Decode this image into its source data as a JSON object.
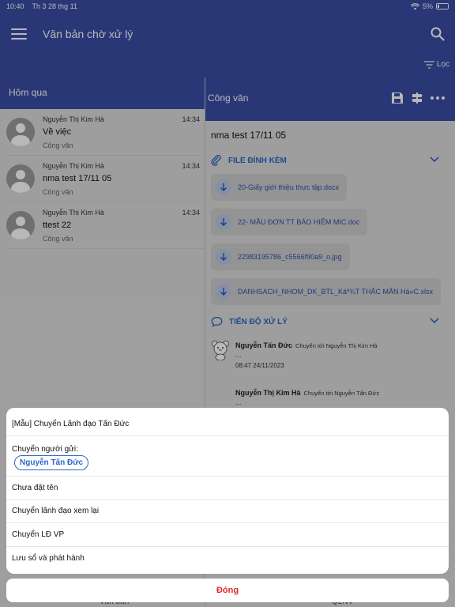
{
  "status_bar": {
    "time": "10:40",
    "date": "Th 3 28 thg 11",
    "battery": "5%"
  },
  "header": {
    "title": "Văn bản chờ xử lý",
    "filter_label": "Lọc"
  },
  "list": {
    "group_label": "Hôm qua",
    "items": [
      {
        "sender": "Nguyễn Thị Kim Hà",
        "time": "14:34",
        "subject": "Về việc",
        "type": "Công văn"
      },
      {
        "sender": "Nguyễn Thị Kim Hà",
        "time": "14:34",
        "subject": "nma test 17/11 05",
        "type": "Công văn"
      },
      {
        "sender": "Nguyễn Thị Kim Hà",
        "time": "14:34",
        "subject": "ttest 22",
        "type": "Công văn"
      }
    ]
  },
  "detail": {
    "header_label": "Công văn",
    "title": "nma test 17/11 05",
    "attachments_label": "FILE ĐÍNH KÈM",
    "attachments": [
      "20-Giấy giới thiệu thực tập.docx",
      "22- MẪU ĐƠN TT BẢO HIỂM MIC.doc",
      "22983195786_c5566f90a9_o.jpg",
      "DANHSACH_NHOM_DK_BTL_Káº¾T THÃC MÃN Há»C.xlsx"
    ],
    "progress_label": "TIẾN ĐỘ XỬ LÝ",
    "progress": [
      {
        "name": "Nguyễn Tấn  Đức",
        "action": "Chuyển tới Nguyễn Thị Kim Hà",
        "note": "...",
        "timestamp": "08:47 24/11/2023"
      },
      {
        "name": "Nguyễn Thị Kim Hà",
        "action": "Chuyển tới Nguyễn Tấn  Đức",
        "note": "..."
      }
    ]
  },
  "bottom_tabs": {
    "left": "Văn bản",
    "right": "QLNV"
  },
  "action_sheet": {
    "option_template": "[Mẫu] Chuyển Lãnh đạo Tấn Đức",
    "sender_label": "Chuyển người gửi:",
    "sender_chip": "Nguyễn Tấn  Đức",
    "option_unnamed": "Chưa đặt tên",
    "option_review": "Chuyển lãnh đạo xem lại",
    "option_ld_vp": "Chuyển LĐ VP",
    "option_archive": "Lưu sổ và phát hành",
    "close_label": "Đóng"
  }
}
